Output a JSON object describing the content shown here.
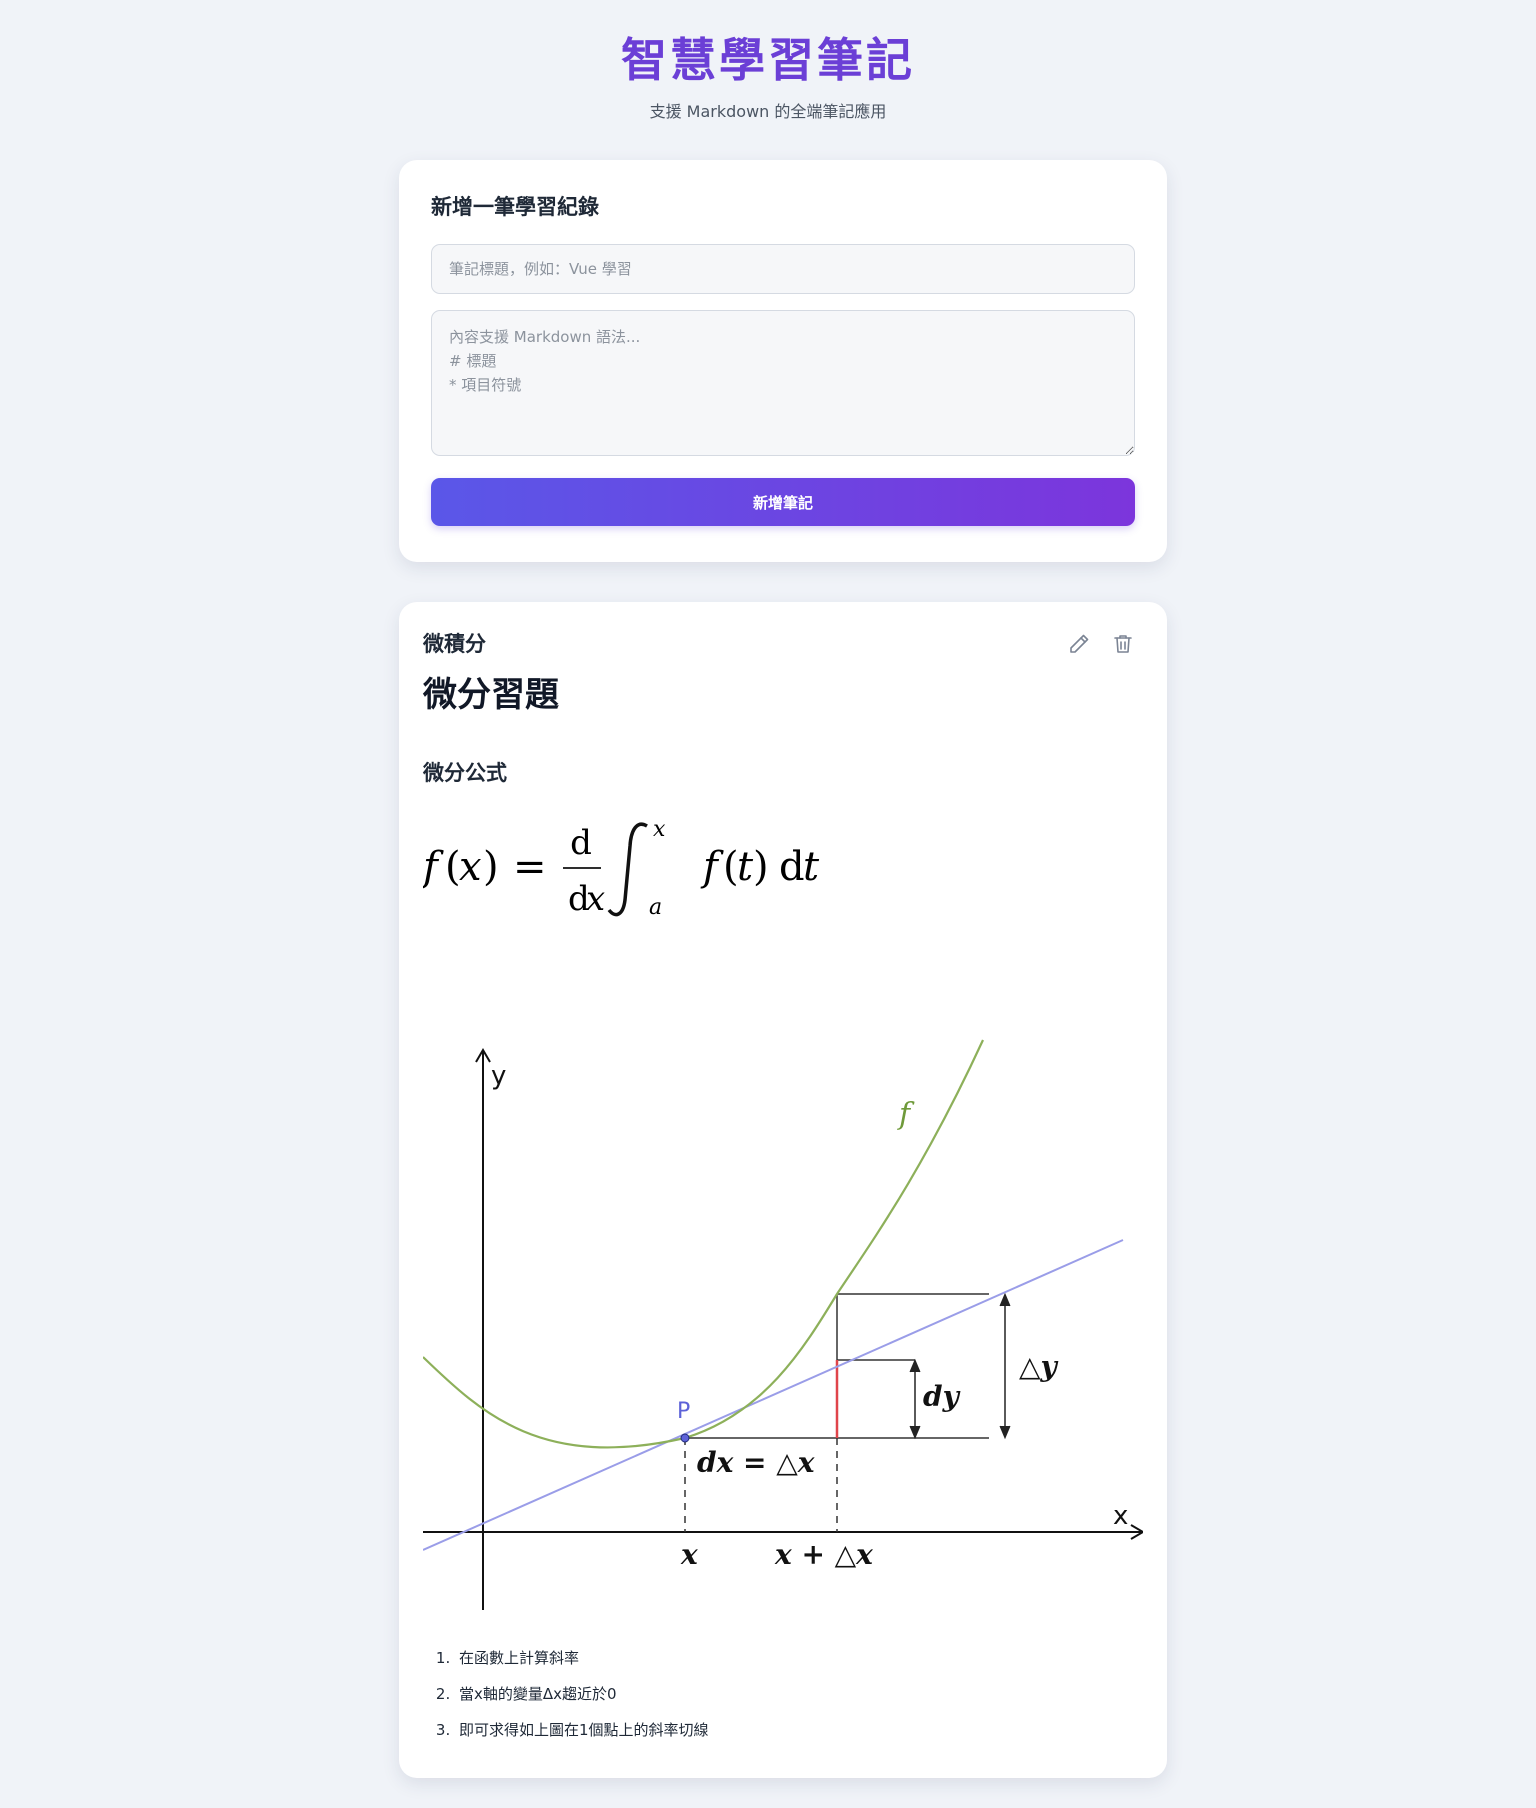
{
  "app": {
    "title": "智慧學習筆記",
    "subtitle": "支援 Markdown 的全端筆記應用"
  },
  "form": {
    "heading": "新增一筆學習紀錄",
    "title_placeholder": "筆記標題，例如：Vue 學習",
    "content_placeholder": "內容支援 Markdown 語法...\n# 標題\n* 項目符號",
    "submit_label": "新增筆記"
  },
  "note": {
    "category": "微積分",
    "title": "微分習題",
    "section_heading": "微分公式",
    "actions": {
      "edit_icon": "pencil-icon",
      "delete_icon": "trash-icon"
    },
    "diagram": {
      "y_axis_label": "y",
      "x_axis_label": "x",
      "curve_label": "f",
      "point_label": "P",
      "dy_label": "dy",
      "delta_y_label": "△y",
      "dx_label": "dx = △x",
      "x_tick_label": "x",
      "x_plus_dx_label": "x + △x",
      "colors": {
        "curve": "#8db05a",
        "tangent": "#9a9de8",
        "point": "#5d62d8",
        "highlight": "#e0444a"
      }
    },
    "steps": [
      "在函數上計算斜率",
      "當x軸的變量Δx趨近於0",
      "即可求得如上圖在1個點上的斜率切線"
    ]
  }
}
